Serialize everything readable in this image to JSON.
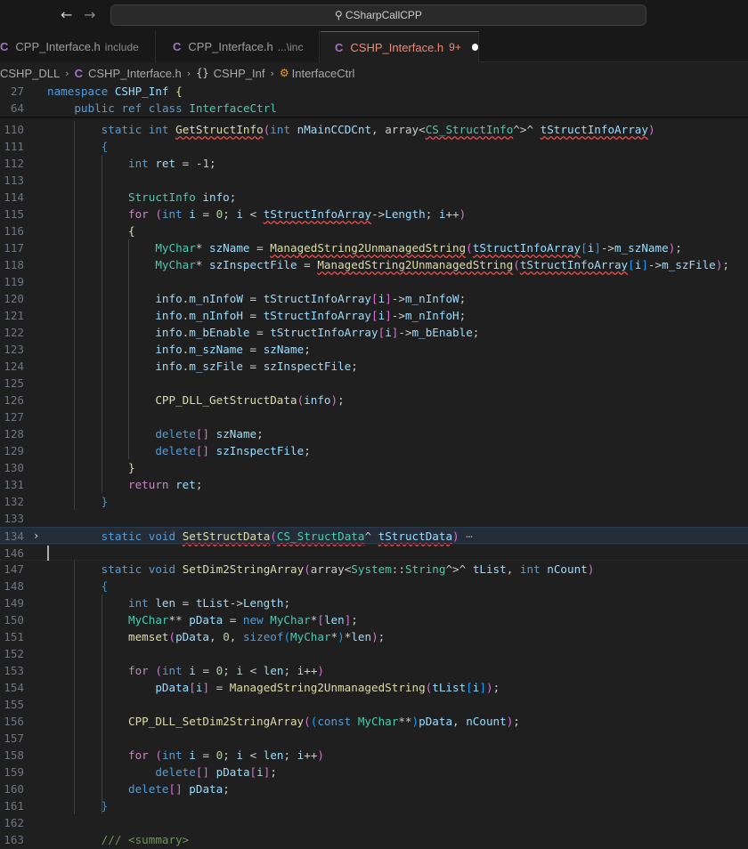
{
  "titlebar": {
    "back_icon": "arrow-left-icon",
    "forward_icon": "arrow-right-icon",
    "search_icon": "search-icon",
    "command_center_text": "CSharpCallCPP"
  },
  "tabs": [
    {
      "label": "CPP_Interface.h",
      "description": "include",
      "active": false
    },
    {
      "label": "CPP_Interface.h",
      "description": "...\\inc",
      "active": false
    },
    {
      "label": "CSHP_Interface.h",
      "badge": "9+",
      "active": true,
      "modified": true
    }
  ],
  "breadcrumb": [
    "CSHP_DLL",
    "CSHP_Interface.h",
    "CSHP_Inf",
    "InterfaceCtrl"
  ],
  "colors": {
    "editor_background": "#1f1f1f",
    "keyword": "#569cd6",
    "type": "#4ec9b0",
    "function": "#dcdcaa",
    "variable": "#9cdcfe",
    "error_squiggle": "#f14c4c",
    "active_tab_text": "#f48771"
  },
  "editor": {
    "sticky_lines": [
      {
        "number": "27",
        "text": "namespace CSHP_Inf {"
      },
      {
        "number": "64",
        "text": "    public ref class InterfaceCtrl"
      }
    ],
    "lines": [
      {
        "number": "110",
        "text": "        static int GetStructInfo(int nMainCCDCnt, array<CS_StructInfo^>^ tStructInfoArray)"
      },
      {
        "number": "111",
        "text": "        {"
      },
      {
        "number": "112",
        "text": "            int ret = -1;"
      },
      {
        "number": "113",
        "text": ""
      },
      {
        "number": "114",
        "text": "            StructInfo info;"
      },
      {
        "number": "115",
        "text": "            for (int i = 0; i < tStructInfoArray->Length; i++)"
      },
      {
        "number": "116",
        "text": "            {"
      },
      {
        "number": "117",
        "text": "                MyChar* szName = ManagedString2UnmanagedString(tStructInfoArray[i]->m_szName);"
      },
      {
        "number": "118",
        "text": "                MyChar* szInspectFile = ManagedString2UnmanagedString(tStructInfoArray[i]->m_szFile);"
      },
      {
        "number": "119",
        "text": ""
      },
      {
        "number": "120",
        "text": "                info.m_nInfoW = tStructInfoArray[i]->m_nInfoW;"
      },
      {
        "number": "121",
        "text": "                info.m_nInfoH = tStructInfoArray[i]->m_nInfoH;"
      },
      {
        "number": "122",
        "text": "                info.m_bEnable = tStructInfoArray[i]->m_bEnable;"
      },
      {
        "number": "123",
        "text": "                info.m_szName = szName;"
      },
      {
        "number": "124",
        "text": "                info.m_szFile = szInspectFile;"
      },
      {
        "number": "125",
        "text": ""
      },
      {
        "number": "126",
        "text": "                CPP_DLL_GetStructData(info);"
      },
      {
        "number": "127",
        "text": ""
      },
      {
        "number": "128",
        "text": "                delete[] szName;"
      },
      {
        "number": "129",
        "text": "                delete[] szInspectFile;"
      },
      {
        "number": "130",
        "text": "            }"
      },
      {
        "number": "131",
        "text": "            return ret;"
      },
      {
        "number": "132",
        "text": "        }"
      },
      {
        "number": "133",
        "text": ""
      },
      {
        "number": "134",
        "text": "        static void SetStructData(CS_StructData^ tStructData)",
        "folded": true,
        "ellipsis": "⋯"
      },
      {
        "number": "146",
        "text": ""
      },
      {
        "number": "147",
        "text": "        static void SetDim2StringArray(array<System::String^>^ tList, int nCount)"
      },
      {
        "number": "148",
        "text": "        {"
      },
      {
        "number": "149",
        "text": "            int len = tList->Length;"
      },
      {
        "number": "150",
        "text": "            MyChar** pData = new MyChar*[len];"
      },
      {
        "number": "151",
        "text": "            memset(pData, 0, sizeof(MyChar*)*len);"
      },
      {
        "number": "152",
        "text": ""
      },
      {
        "number": "153",
        "text": "            for (int i = 0; i < len; i++)"
      },
      {
        "number": "154",
        "text": "                pData[i] = ManagedString2UnmanagedString(tList[i]);"
      },
      {
        "number": "155",
        "text": ""
      },
      {
        "number": "156",
        "text": "            CPP_DLL_SetDim2StringArray((const MyChar**)pData, nCount);"
      },
      {
        "number": "157",
        "text": ""
      },
      {
        "number": "158",
        "text": "            for (int i = 0; i < len; i++)"
      },
      {
        "number": "159",
        "text": "                delete[] pData[i];"
      },
      {
        "number": "160",
        "text": "            delete[] pData;"
      },
      {
        "number": "161",
        "text": "        }"
      },
      {
        "number": "162",
        "text": ""
      },
      {
        "number": "163",
        "text": "        /// <summary>"
      }
    ]
  }
}
